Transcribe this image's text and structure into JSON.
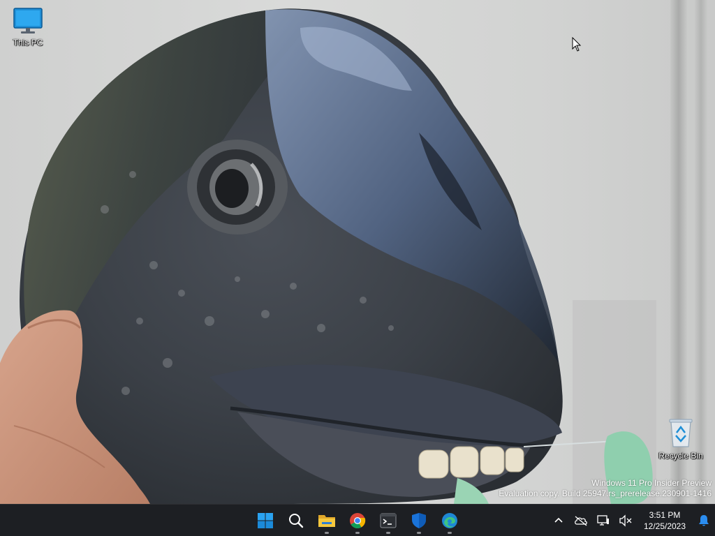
{
  "desktop": {
    "icons": [
      {
        "id": "this-pc",
        "label": "This PC",
        "icon": "monitor-icon"
      },
      {
        "id": "recycle-bin",
        "label": "Recycle Bin",
        "icon": "recycle-bin-icon"
      }
    ]
  },
  "watermark": {
    "line1": "Windows 11 Pro Insider Preview",
    "line2": "Evaluation copy. Build 25947.rs_prerelease.230901-1416"
  },
  "taskbar": {
    "pinned": [
      {
        "name": "start",
        "icon": "windows-start-icon",
        "running": false
      },
      {
        "name": "search",
        "icon": "search-icon",
        "running": false
      },
      {
        "name": "file-explorer",
        "icon": "folder-icon",
        "running": true
      },
      {
        "name": "chrome",
        "icon": "chrome-icon",
        "running": true
      },
      {
        "name": "terminal",
        "icon": "terminal-icon",
        "running": true
      },
      {
        "name": "windows-security",
        "icon": "shield-icon",
        "running": true
      },
      {
        "name": "edge",
        "icon": "edge-icon",
        "running": true
      }
    ],
    "tray": {
      "icons": [
        "chevron-up-icon",
        "onedrive-offline-icon",
        "network-icon",
        "volume-muted-icon"
      ],
      "time": "3:51 PM",
      "date": "12/25/2023",
      "notification_icon": "bell-icon"
    }
  },
  "colors": {
    "taskbar_bg": "#1d1f23",
    "accent_blue": "#0a74da",
    "text_light": "#ffffff"
  }
}
